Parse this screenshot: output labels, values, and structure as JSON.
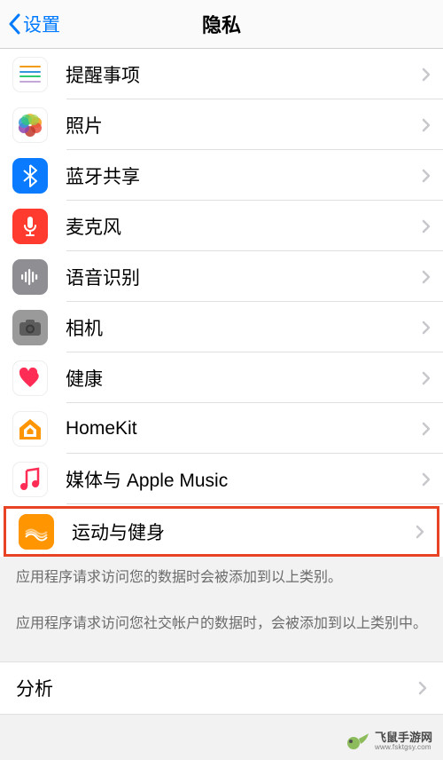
{
  "header": {
    "back": "设置",
    "title": "隐私"
  },
  "rows": [
    {
      "id": "reminders",
      "label": "提醒事项"
    },
    {
      "id": "photos",
      "label": "照片"
    },
    {
      "id": "bluetooth",
      "label": "蓝牙共享"
    },
    {
      "id": "microphone",
      "label": "麦克风"
    },
    {
      "id": "speech",
      "label": "语音识别"
    },
    {
      "id": "camera",
      "label": "相机"
    },
    {
      "id": "health",
      "label": "健康"
    },
    {
      "id": "homekit",
      "label": "HomeKit"
    },
    {
      "id": "media",
      "label": "媒体与 Apple Music"
    },
    {
      "id": "motion",
      "label": "运动与健身"
    }
  ],
  "footer1": "应用程序请求访问您的数据时会被添加到以上类别。",
  "footer2": "应用程序请求访问您社交帐户的数据时，会被添加到以上类别中。",
  "analysis": "分析",
  "watermark": {
    "cn": "飞鼠手游网",
    "en": "www.fsktgsy.com"
  }
}
